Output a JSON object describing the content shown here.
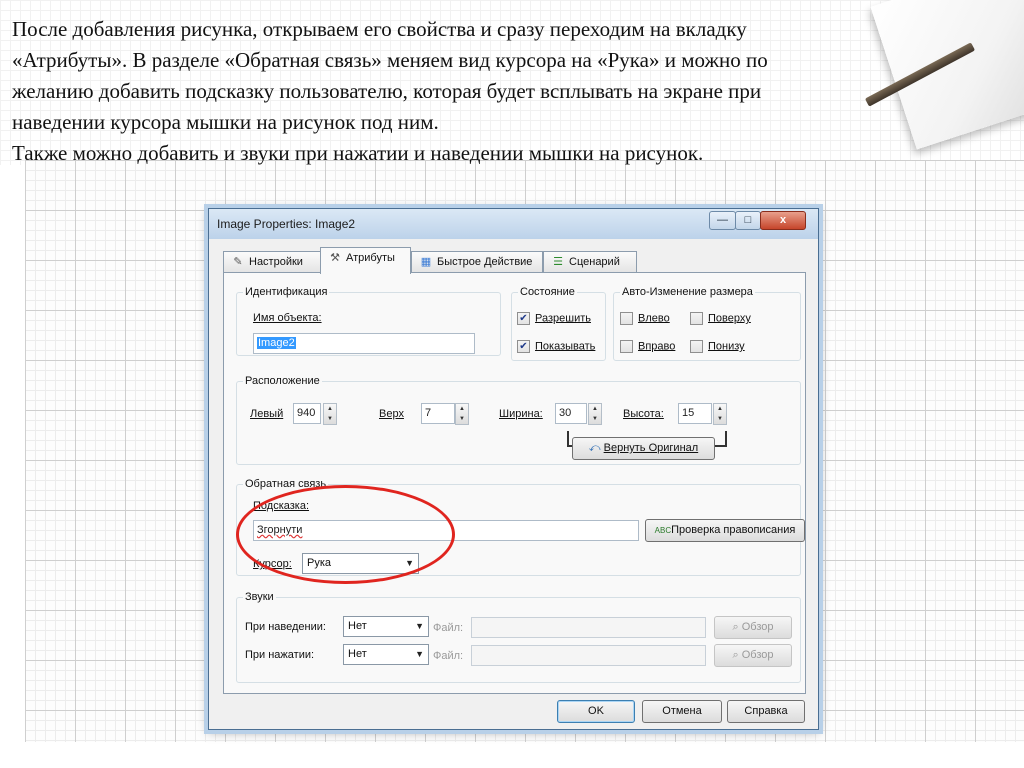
{
  "intro": {
    "line1": "После добавления рисунка, открываем его свойства и сразу переходим на вкладку",
    "line2": "«Атрибуты». В разделе «Обратная связь» меняем вид курсора на «Рука» и можно по",
    "line3": "желанию добавить подсказку пользователю, которая будет всплывать на экране при",
    "line4": "наведении курсора мышки на рисунок под ним.",
    "line5": "Также можно добавить и звуки при нажатии и наведении мышки на рисунок."
  },
  "dialog": {
    "title": "Image Properties: Image2",
    "window_buttons": {
      "minimize": "—",
      "maximize": "□",
      "close": "x"
    },
    "tabs": [
      {
        "label": "Настройки",
        "icon": "pencil-icon"
      },
      {
        "label": "Атрибуты",
        "icon": "tools-icon"
      },
      {
        "label": "Быстрое Действие",
        "icon": "action-icon"
      },
      {
        "label": "Сценарий",
        "icon": "script-icon"
      }
    ],
    "identification": {
      "legend": "Идентификация",
      "name_label": "Имя объекта:",
      "name_value": "Image2"
    },
    "state": {
      "legend": "Состояние",
      "enable_label": "Разрешить",
      "enable_checked": true,
      "show_label": "Показывать",
      "show_checked": true
    },
    "autosize": {
      "legend": "Авто-Изменение размера",
      "left_label": "Влево",
      "top_label": "Поверху",
      "right_label": "Вправо",
      "bottom_label": "Понизу"
    },
    "position": {
      "legend": "Расположение",
      "left_label": "Левый",
      "left_value": "940",
      "top_label": "Верх",
      "top_value": "7",
      "width_label": "Ширина:",
      "width_value": "30",
      "height_label": "Высота:",
      "height_value": "15",
      "restore_label": "Вернуть Оригинал"
    },
    "feedback": {
      "legend": "Обратная связь",
      "tooltip_label": "Подсказка:",
      "tooltip_value": "Згорнути",
      "spellcheck_label": "Проверка правописания",
      "spellcheck_icon_text": "ABC",
      "cursor_label": "Курсор:",
      "cursor_value": "Рука"
    },
    "sounds": {
      "legend": "Звуки",
      "hover_label": "При наведении:",
      "hover_value": "Нет",
      "click_label": "При нажатии:",
      "click_value": "Нет",
      "file_label": "Файл:",
      "browse_label": "Обзор"
    },
    "footer": {
      "ok": "OK",
      "cancel": "Отмена",
      "help": "Справка"
    }
  }
}
